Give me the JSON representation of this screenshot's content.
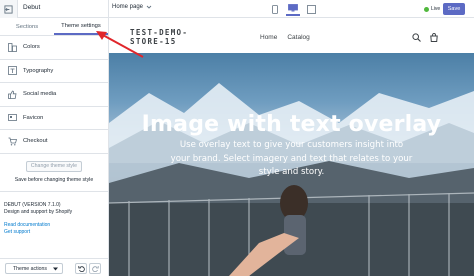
{
  "topbar": {
    "theme_name": "Debut",
    "page_selector": "Home page",
    "live_label": "Live",
    "save_label": "Save"
  },
  "sidebar": {
    "tabs": [
      {
        "label": "Sections"
      },
      {
        "label": "Theme settings"
      }
    ],
    "items": [
      {
        "label": "Colors",
        "icon": "color-swatch-icon"
      },
      {
        "label": "Typography",
        "icon": "typography-icon"
      },
      {
        "label": "Social media",
        "icon": "thumbs-up-icon"
      },
      {
        "label": "Favicon",
        "icon": "favicon-icon"
      },
      {
        "label": "Checkout",
        "icon": "cart-icon"
      }
    ],
    "change_theme_label": "Change theme style",
    "change_theme_note": "Save before changing theme style",
    "theme_version": "DEBUT (VERSION 7.1.0)",
    "design_support": "Design and support by Shopify",
    "read_docs": "Read documentation",
    "get_support": "Get support",
    "theme_actions_label": "Theme actions"
  },
  "preview": {
    "store_name": "TEST-DEMO-STORE-15",
    "nav": [
      "Home",
      "Catalog"
    ],
    "hero_heading": "Image with text overlay",
    "hero_text": "Use overlay text to give your customers insight into your brand. Select imagery and text that relates to your style and story."
  },
  "colors": {
    "accent": "#5c6ac4",
    "live_dot": "#50b83c",
    "annotation_arrow": "#e0262b"
  }
}
